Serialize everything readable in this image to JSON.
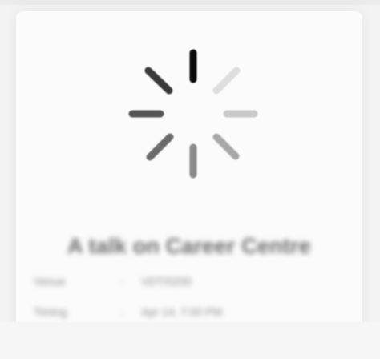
{
  "event": {
    "title": "A talk on Career Centre"
  },
  "details": {
    "venue_label": "Venue",
    "venue_separator": ":",
    "venue_value": "VDT/0200",
    "timing_label": "Timing",
    "timing_separator": ":",
    "timing_value": "Apr 14, 7:00 PM"
  },
  "loading_spinner": {
    "icon": "loading-spinner-icon",
    "spoke_colors": [
      "#0b0b0b",
      "#3a3a3a",
      "#555555",
      "#6a6a6a",
      "#8a8a8a",
      "#a8a8a8",
      "#c9c9c9",
      "#dedede"
    ]
  }
}
